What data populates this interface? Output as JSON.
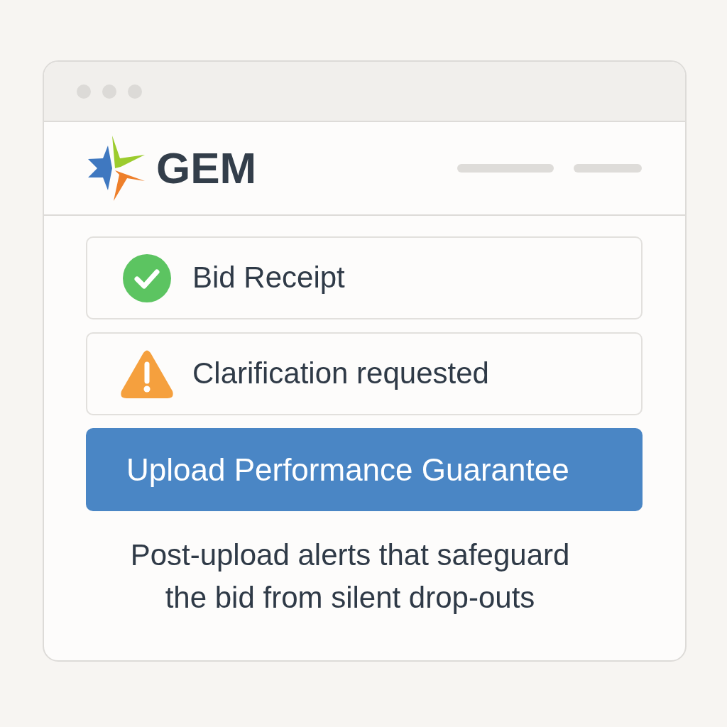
{
  "logo": {
    "text": "GEM"
  },
  "status_items": [
    {
      "kind": "success",
      "label": "Bid Receipt"
    },
    {
      "kind": "warning",
      "label": "Clarification requested"
    }
  ],
  "primary_button": {
    "label": "Upload Performance Guarantee"
  },
  "caption": "Post-upload alerts that safeguard\nthe bid from silent drop-outs"
}
